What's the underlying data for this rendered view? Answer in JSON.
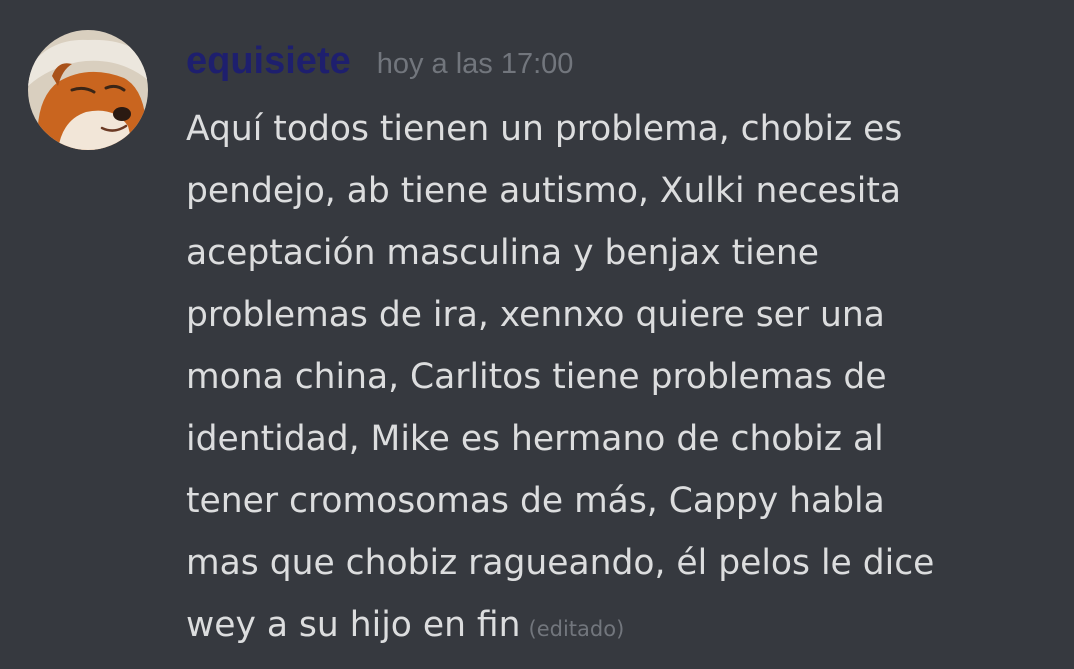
{
  "message": {
    "username": "equisiete",
    "timestamp": "hoy a las 17:00",
    "lines": [
      "Aquí todos tienen un problema, chobiz es",
      "pendejo, ab tiene autismo, Xulki necesita",
      "aceptación masculina y benjax tiene",
      "problemas de ira, xennxo quiere ser una",
      "mona china, Carlitos tiene problemas de",
      "identidad, Mike es hermano de chobiz al",
      "tener cromosomas de más, Cappy habla",
      "mas que chobiz ragueando,  él pelos le dice",
      "wey a su hijo en fin"
    ],
    "edited_label": "(editado)",
    "avatar_icon": "shiba-dog-avatar-icon"
  },
  "colors": {
    "background": "#36393f",
    "username": "#1e1f6e",
    "text": "#dcddde",
    "muted": "#72767d"
  }
}
